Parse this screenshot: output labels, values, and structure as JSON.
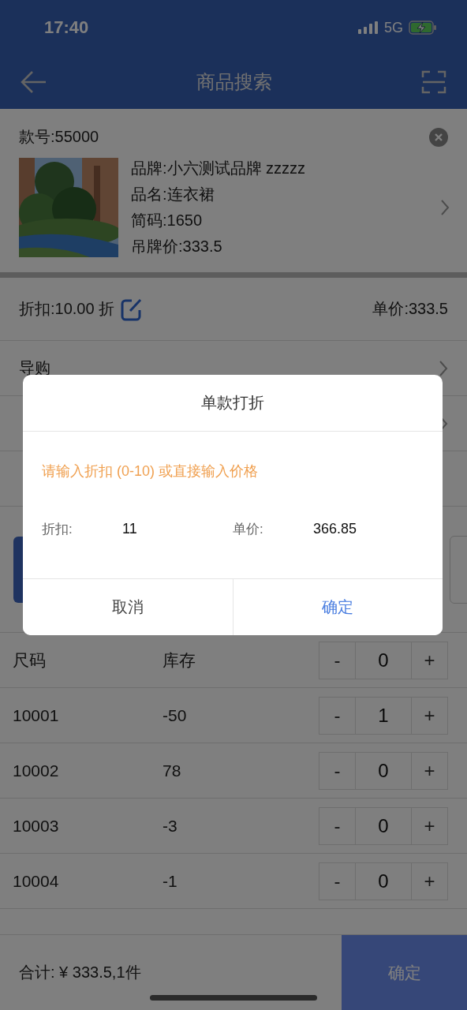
{
  "status_bar": {
    "time": "17:40",
    "network": "5G"
  },
  "nav": {
    "title": "商品搜索"
  },
  "product": {
    "style_no": "款号:55000",
    "lines": [
      "品牌:小六测试品牌 zzzzz",
      "品名:连衣裙",
      "简码:1650",
      "吊牌价:333.5"
    ]
  },
  "discount_row": {
    "discount": "折扣:10.00 折",
    "unit_price": "单价:333.5"
  },
  "menu_rows": [
    {
      "label": "导购"
    }
  ],
  "size_table": {
    "columns": [
      "尺码",
      "库存"
    ],
    "minus": "-",
    "plus": "+",
    "header_qty": "0",
    "rows": [
      {
        "size": "10001",
        "stock": "-50",
        "qty": "1"
      },
      {
        "size": "10002",
        "stock": "78",
        "qty": "0"
      },
      {
        "size": "10003",
        "stock": "-3",
        "qty": "0"
      },
      {
        "size": "10004",
        "stock": "-1",
        "qty": "0"
      }
    ]
  },
  "footer": {
    "total": "合计: ¥ 333.5,1件",
    "confirm": "确定"
  },
  "dialog": {
    "title": "单款打折",
    "hint": "请输入折扣 (0-10) 或直接输入价格",
    "fields": [
      {
        "label": "折扣:",
        "value": "11"
      },
      {
        "label": "单价:",
        "value": "366.85"
      }
    ],
    "buttons": [
      {
        "label": "取消",
        "kind": "cancel"
      },
      {
        "label": "确定",
        "kind": "confirm"
      }
    ]
  }
}
